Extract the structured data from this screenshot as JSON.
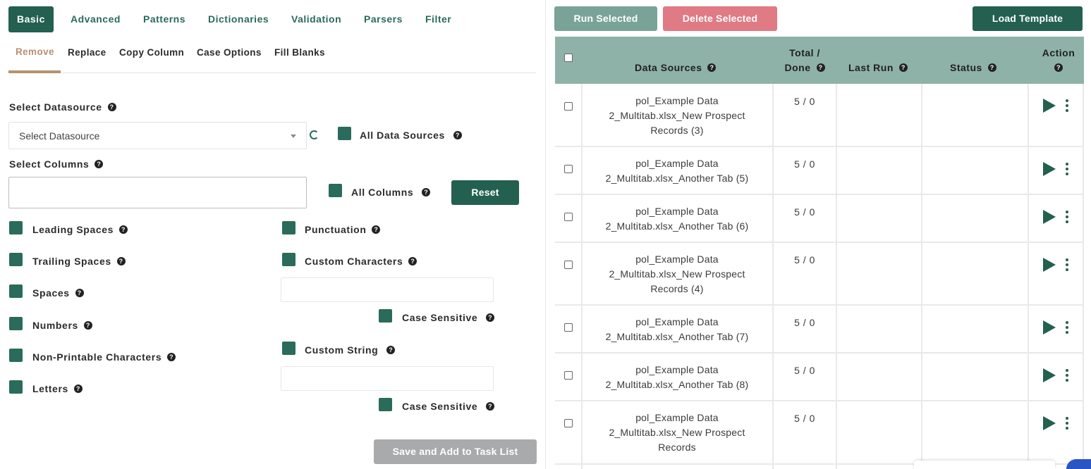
{
  "colors": {
    "accent": "#23604f",
    "tab_active_sub": "#b88f70",
    "danger": "#e07a84",
    "muted_green": "#7aa398",
    "disabled": "#a9aaac",
    "table_header": "#8fb2a8"
  },
  "tabs": [
    "Basic",
    "Advanced",
    "Patterns",
    "Dictionaries",
    "Validation",
    "Parsers",
    "Filter"
  ],
  "subtabs": [
    "Remove",
    "Replace",
    "Copy Column",
    "Case Options",
    "Fill Blanks"
  ],
  "form": {
    "select_datasource_label": "Select Datasource",
    "select_datasource_placeholder": "Select Datasource",
    "all_data_sources": "All Data Sources",
    "select_columns_label": "Select Columns",
    "all_columns": "All Columns",
    "reset": "Reset",
    "left_options": [
      "Leading Spaces",
      "Trailing Spaces",
      "Spaces",
      "Numbers",
      "Non-Printable Characters",
      "Letters"
    ],
    "punctuation": "Punctuation",
    "custom_characters": "Custom Characters",
    "case_sensitive": "Case Sensitive",
    "custom_string": "Custom String",
    "save_button": "Save and Add to Task List"
  },
  "toolbar": {
    "run_selected": "Run Selected",
    "delete_selected": "Delete Selected",
    "load_template": "Load Template"
  },
  "table": {
    "headers": {
      "data_sources": "Data Sources",
      "total": "Total /",
      "done": "Done",
      "last_run": "Last Run",
      "status": "Status",
      "action": "Action"
    },
    "rows": [
      {
        "lines": [
          "pol_Example Data",
          "2_Multitab.xlsx_New Prospect",
          "Records (3)"
        ],
        "total_done": "5 / 0"
      },
      {
        "lines": [
          "pol_Example Data",
          "2_Multitab.xlsx_Another Tab (5)"
        ],
        "total_done": "5 / 0"
      },
      {
        "lines": [
          "pol_Example Data",
          "2_Multitab.xlsx_Another Tab (6)"
        ],
        "total_done": "5 / 0"
      },
      {
        "lines": [
          "pol_Example Data",
          "2_Multitab.xlsx_New Prospect",
          "Records (4)"
        ],
        "total_done": "5 / 0"
      },
      {
        "lines": [
          "pol_Example Data",
          "2_Multitab.xlsx_Another Tab (7)"
        ],
        "total_done": "5 / 0"
      },
      {
        "lines": [
          "pol_Example Data",
          "2_Multitab.xlsx_Another Tab (8)"
        ],
        "total_done": "5 / 0"
      },
      {
        "lines": [
          "pol_Example Data",
          "2_Multitab.xlsx_New Prospect",
          "Records"
        ],
        "total_done": "5 / 0"
      }
    ]
  }
}
